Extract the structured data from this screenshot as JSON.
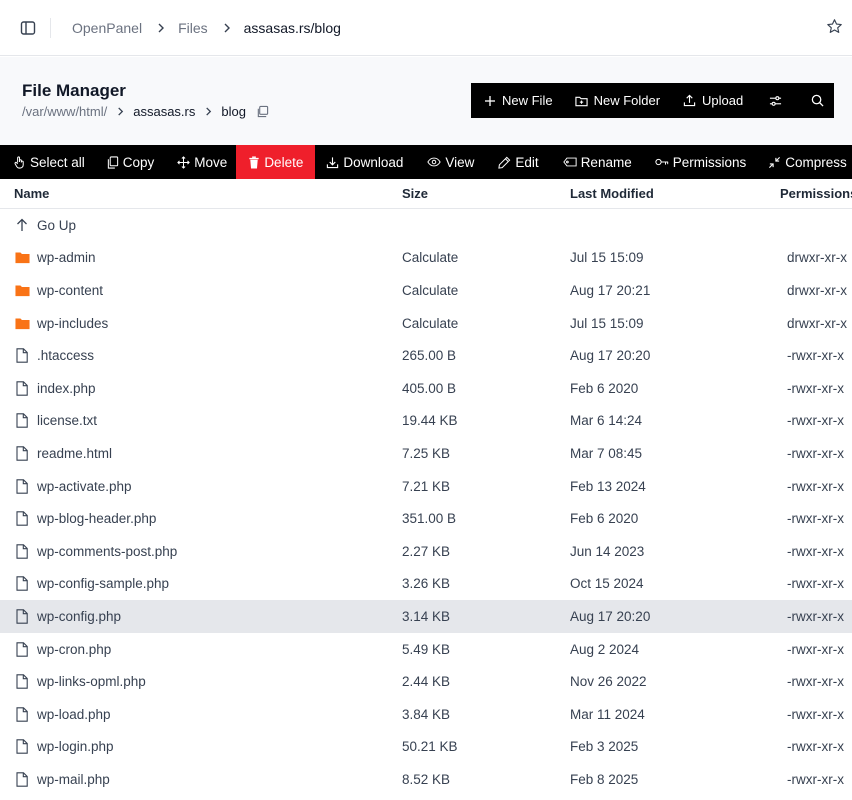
{
  "breadcrumb": [
    "OpenPanel",
    "Files",
    "assasas.rs/blog"
  ],
  "header": {
    "title": "File Manager",
    "path_root": "/var/www/html/",
    "path_segments": [
      "assasas.rs",
      "blog"
    ]
  },
  "actions": {
    "new_file": "New File",
    "new_folder": "New Folder",
    "upload": "Upload"
  },
  "toolbar": {
    "select_all": "Select all",
    "copy": "Copy",
    "move": "Move",
    "delete": "Delete",
    "download": "Download",
    "view": "View",
    "edit": "Edit",
    "rename": "Rename",
    "permissions": "Permissions",
    "compress": "Compress"
  },
  "colors": {
    "folder": "#f97316",
    "delete": "#ef1f2b",
    "toolbar_bg": "#000000"
  },
  "table": {
    "columns": [
      "Name",
      "Size",
      "Last Modified",
      "Permissions"
    ],
    "go_up": "Go Up",
    "rows": [
      {
        "type": "folder",
        "name": "wp-admin",
        "size": "Calculate",
        "modified": "Jul 15 15:09",
        "perms": "drwxr-xr-x"
      },
      {
        "type": "folder",
        "name": "wp-content",
        "size": "Calculate",
        "modified": "Aug 17 20:21",
        "perms": "drwxr-xr-x"
      },
      {
        "type": "folder",
        "name": "wp-includes",
        "size": "Calculate",
        "modified": "Jul 15 15:09",
        "perms": "drwxr-xr-x"
      },
      {
        "type": "file",
        "name": ".htaccess",
        "size": "265.00 B",
        "modified": "Aug 17 20:20",
        "perms": "-rwxr-xr-x"
      },
      {
        "type": "file",
        "name": "index.php",
        "size": "405.00 B",
        "modified": "Feb 6 2020",
        "perms": "-rwxr-xr-x"
      },
      {
        "type": "file",
        "name": "license.txt",
        "size": "19.44 KB",
        "modified": "Mar 6 14:24",
        "perms": "-rwxr-xr-x"
      },
      {
        "type": "file",
        "name": "readme.html",
        "size": "7.25 KB",
        "modified": "Mar 7 08:45",
        "perms": "-rwxr-xr-x"
      },
      {
        "type": "file",
        "name": "wp-activate.php",
        "size": "7.21 KB",
        "modified": "Feb 13 2024",
        "perms": "-rwxr-xr-x"
      },
      {
        "type": "file",
        "name": "wp-blog-header.php",
        "size": "351.00 B",
        "modified": "Feb 6 2020",
        "perms": "-rwxr-xr-x"
      },
      {
        "type": "file",
        "name": "wp-comments-post.php",
        "size": "2.27 KB",
        "modified": "Jun 14 2023",
        "perms": "-rwxr-xr-x"
      },
      {
        "type": "file",
        "name": "wp-config-sample.php",
        "size": "3.26 KB",
        "modified": "Oct 15 2024",
        "perms": "-rwxr-xr-x"
      },
      {
        "type": "file",
        "name": "wp-config.php",
        "size": "3.14 KB",
        "modified": "Aug 17 20:20",
        "perms": "-rwxr-xr-x",
        "selected": true
      },
      {
        "type": "file",
        "name": "wp-cron.php",
        "size": "5.49 KB",
        "modified": "Aug 2 2024",
        "perms": "-rwxr-xr-x"
      },
      {
        "type": "file",
        "name": "wp-links-opml.php",
        "size": "2.44 KB",
        "modified": "Nov 26 2022",
        "perms": "-rwxr-xr-x"
      },
      {
        "type": "file",
        "name": "wp-load.php",
        "size": "3.84 KB",
        "modified": "Mar 11 2024",
        "perms": "-rwxr-xr-x"
      },
      {
        "type": "file",
        "name": "wp-login.php",
        "size": "50.21 KB",
        "modified": "Feb 3 2025",
        "perms": "-rwxr-xr-x"
      },
      {
        "type": "file",
        "name": "wp-mail.php",
        "size": "8.52 KB",
        "modified": "Feb 8 2025",
        "perms": "-rwxr-xr-x"
      }
    ]
  }
}
